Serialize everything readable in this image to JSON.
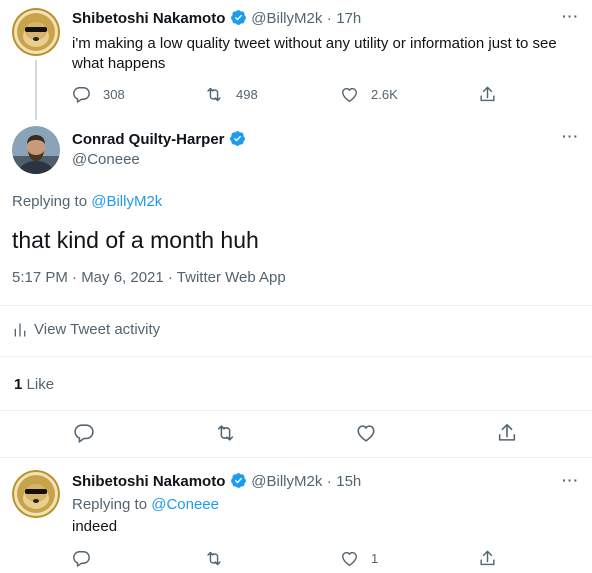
{
  "tweet1": {
    "name": "Shibetoshi Nakamoto",
    "handle": "@BillyM2k",
    "dot": "·",
    "time": "17h",
    "text_line1": "i'm making a low quality tweet without any utility or information just to see",
    "text_line2": "what happens",
    "replies": "308",
    "retweets": "498",
    "likes": "2.6K"
  },
  "main": {
    "name": "Conrad Quilty-Harper",
    "handle": "@Coneee",
    "replying_prefix": "Replying to",
    "replying_to": "@BillyM2k",
    "text": "that kind of a month huh",
    "timestamp": "5:17 PM · May 6, 2021 · Twitter Web App",
    "activity": "View Tweet activity",
    "like_count": "1",
    "like_label": "Like"
  },
  "tweet3": {
    "name": "Shibetoshi Nakamoto",
    "handle": "@BillyM2k",
    "dot": "·",
    "time": "15h",
    "replying_prefix": "Replying to",
    "replying_to": "@Coneee",
    "text": "indeed",
    "likes": "1"
  },
  "colors": {
    "accent": "#1d9bf0",
    "text": "#0f1419",
    "muted": "#536471",
    "divider": "#eff3f4"
  }
}
